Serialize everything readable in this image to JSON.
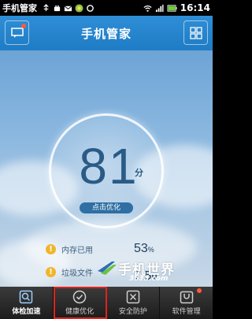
{
  "status_bar": {
    "title": "手机管家",
    "time": "16:14"
  },
  "header": {
    "title": "手机管家"
  },
  "score": {
    "value": "81",
    "unit": "分",
    "button_label": "点击优化"
  },
  "stats": [
    {
      "label": "内存已用",
      "value": "53",
      "unit": "%"
    },
    {
      "label": "垃圾文件",
      "value": "7.5",
      "unit": "M"
    }
  ],
  "watermark": {
    "text": "手机世界",
    "sub": "3533.com"
  },
  "tabs": [
    {
      "label": "体检加速",
      "icon": "magnifier-icon"
    },
    {
      "label": "健康优化",
      "icon": "check-circle-icon"
    },
    {
      "label": "安全防护",
      "icon": "shield-icon"
    },
    {
      "label": "软件管理",
      "icon": "bag-icon"
    }
  ],
  "colors": {
    "header_blue": "#2e8ed6",
    "score_text": "#2a5b86",
    "warning_orange": "#f1b52a",
    "highlight_red": "#e0231c"
  }
}
